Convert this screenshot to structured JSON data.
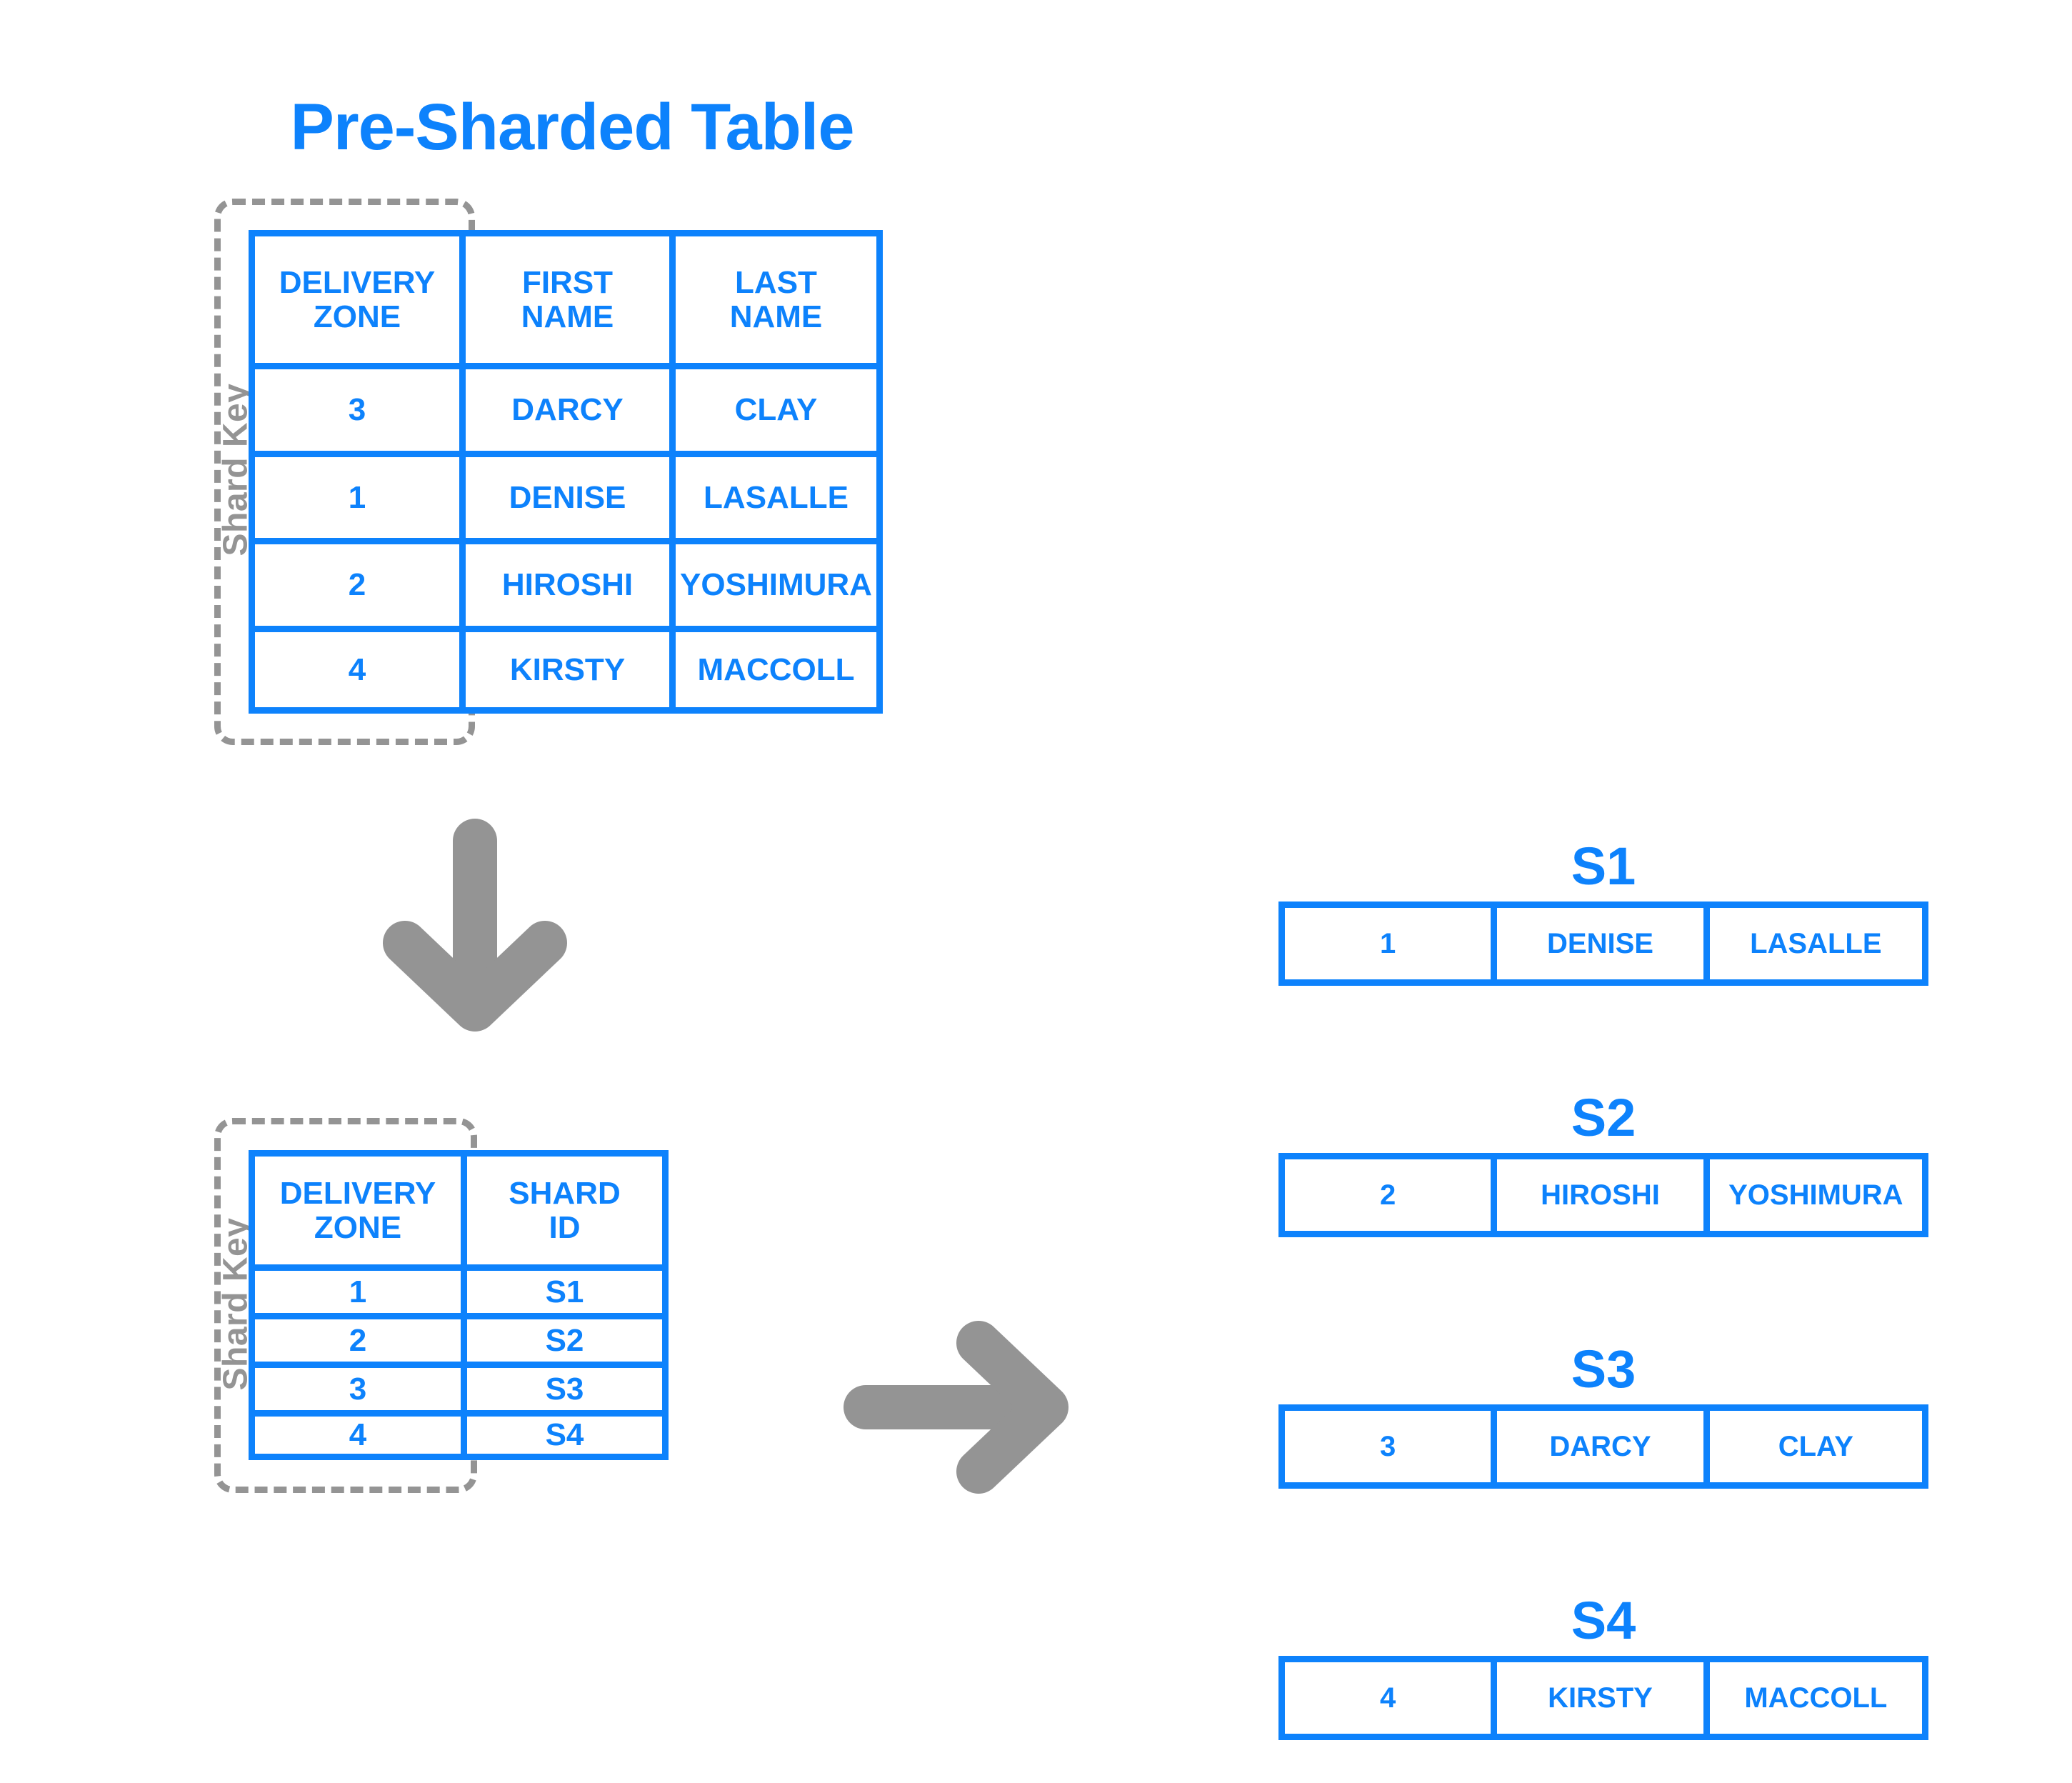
{
  "title": "Pre-Sharded Table",
  "colors": {
    "blue": "#0d82fc",
    "gray": "#949494"
  },
  "shard_key_label": "Shard Key",
  "presharded_table": {
    "headers": [
      "DELIVERY ZONE",
      "FIRST NAME",
      "LAST NAME"
    ],
    "headers_wrapped": [
      [
        "DELIVERY",
        "ZONE"
      ],
      [
        "FIRST",
        "NAME"
      ],
      [
        "LAST",
        "NAME"
      ]
    ],
    "rows": [
      [
        "3",
        "DARCY",
        "CLAY"
      ],
      [
        "1",
        "DENISE",
        "LASALLE"
      ],
      [
        "2",
        "HIROSHI",
        "YOSHIMURA"
      ],
      [
        "4",
        "KIRSTY",
        "MACCOLL"
      ]
    ]
  },
  "shard_map_table": {
    "headers": [
      "DELIVERY ZONE",
      "SHARD ID"
    ],
    "headers_wrapped": [
      [
        "DELIVERY",
        "ZONE"
      ],
      [
        "SHARD",
        "ID"
      ]
    ],
    "rows": [
      [
        "1",
        "S1"
      ],
      [
        "2",
        "S2"
      ],
      [
        "3",
        "S3"
      ],
      [
        "4",
        "S4"
      ]
    ]
  },
  "shards": [
    {
      "label": "S1",
      "cells": [
        "1",
        "DENISE",
        "LASALLE"
      ]
    },
    {
      "label": "S2",
      "cells": [
        "2",
        "HIROSHI",
        "YOSHIMURA"
      ]
    },
    {
      "label": "S3",
      "cells": [
        "3",
        "DARCY",
        "CLAY"
      ]
    },
    {
      "label": "S4",
      "cells": [
        "4",
        "KIRSTY",
        "MACCOLL"
      ]
    }
  ],
  "arrows": [
    {
      "name": "down-arrow",
      "direction": "down"
    },
    {
      "name": "right-arrow",
      "direction": "right"
    }
  ]
}
